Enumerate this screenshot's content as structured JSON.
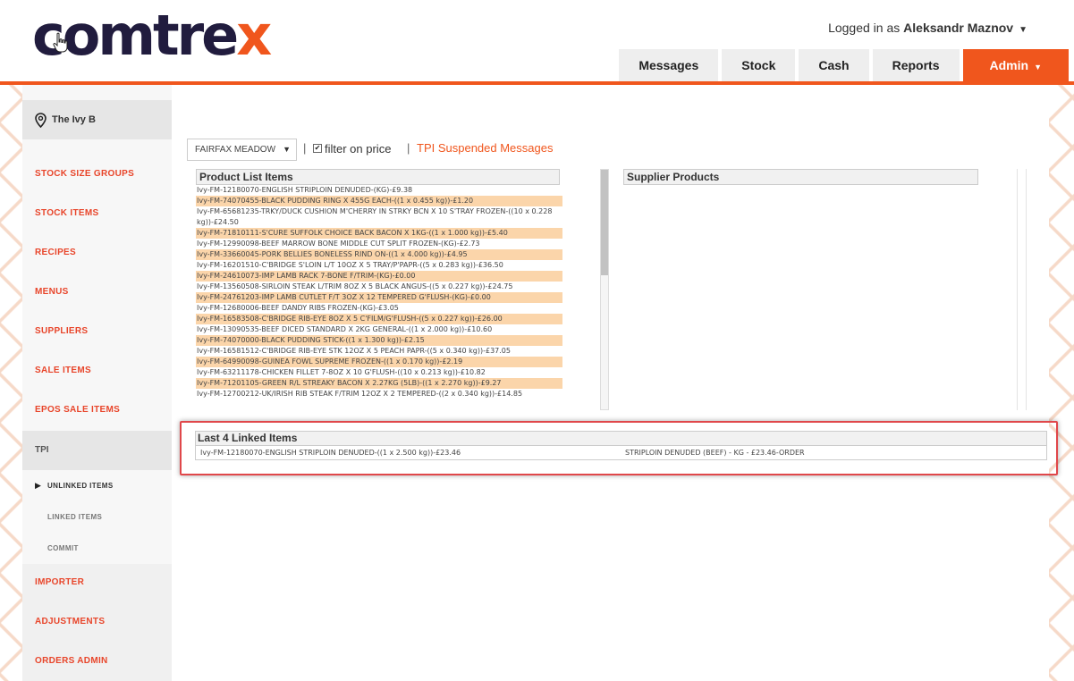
{
  "brand": {
    "logo_main": "comtre",
    "logo_accent": "x",
    "accent_color": "#f0561d",
    "navy": "#211c3e"
  },
  "user": {
    "prefix": "Logged in as ",
    "name": "Aleksandr Maznov"
  },
  "nav": {
    "messages": "Messages",
    "stock": "Stock",
    "cash": "Cash",
    "reports": "Reports",
    "admin": "Admin"
  },
  "sidebar": {
    "site": "The Ivy B",
    "items": {
      "stock_size_groups": "STOCK SIZE GROUPS",
      "stock_items": "STOCK ITEMS",
      "recipes": "RECIPES",
      "menus": "MENUS",
      "suppliers": "SUPPLIERS",
      "sale_items": "SALE ITEMS",
      "epos_sale_items": "EPOS SALE ITEMS",
      "tpi": "TPI",
      "unlinked_items": "UNLINKED ITEMS",
      "linked_items": "LINKED ITEMS",
      "commit": "COMMIT",
      "importer": "IMPORTER",
      "adjustments": "ADJUSTMENTS",
      "orders_admin": "ORDERS ADMIN"
    }
  },
  "toolbar": {
    "supplier_selected": "FAIRFAX MEADOW",
    "filter_label": "filter on price",
    "filter_checked": true,
    "tpi_link": "TPI Suspended Messages"
  },
  "product_list": {
    "title": "Product List Items",
    "items": [
      "Ivy-FM-12180070-ENGLISH STRIPLOIN DENUDED-(KG)-£9.38",
      "Ivy-FM-74070455-BLACK PUDDING RING X 455G EACH-((1 x 0.455 kg))-£1.20",
      "Ivy-FM-65681235-TRKY/DUCK CUSHION M'CHERRY IN STRKY BCN X 10 S'TRAY FROZEN-((10 x 0.228 kg))-£24.50",
      "Ivy-FM-71810111-S'CURE SUFFOLK CHOICE BACK BACON X 1KG-((1 x 1.000 kg))-£5.40",
      "Ivy-FM-12990098-BEEF MARROW BONE MIDDLE CUT SPLIT FROZEN-(KG)-£2.73",
      "Ivy-FM-33660045-PORK BELLIES BONELESS RIND ON-((1 x 4.000 kg))-£4.95",
      "Ivy-FM-16201510-C'BRIDGE S'LOIN L/T 10OZ X 5 TRAY/P'PAPR-((5 x 0.283 kg))-£36.50",
      "Ivy-FM-24610073-IMP LAMB RACK 7-BONE F/TRIM-(KG)-£0.00",
      "Ivy-FM-13560508-SIRLOIN STEAK L/TRIM 8OZ X 5 BLACK ANGUS-((5 x 0.227 kg))-£24.75",
      "Ivy-FM-24761203-IMP LAMB CUTLET F/T 3OZ X 12 TEMPERED G'FLUSH-(KG)-£0.00",
      "Ivy-FM-12680006-BEEF DANDY RIBS FROZEN-(KG)-£3.05",
      "Ivy-FM-16583508-C'BRIDGE RIB-EYE 8OZ X 5 C'FILM/G'FLUSH-((5 x 0.227 kg))-£26.00",
      "Ivy-FM-13090535-BEEF DICED STANDARD X 2KG GENERAL-((1 x 2.000 kg))-£10.60",
      "Ivy-FM-74070000-BLACK PUDDING STICK-((1 x 1.300 kg))-£2.15",
      "Ivy-FM-16581512-C'BRIDGE RIB-EYE STK 12OZ X 5 PEACH PAPR-((5 x 0.340 kg))-£37.05",
      "Ivy-FM-64990098-GUINEA FOWL SUPREME FROZEN-((1 x 0.170 kg))-£2.19",
      "Ivy-FM-63211178-CHICKEN FILLET 7-8OZ X 10 G'FLUSH-((10 x 0.213 kg))-£10.82",
      "Ivy-FM-71201105-GREEN R/L STREAKY BACON X 2.27KG (5LB)-((1 x 2.270 kg))-£9.27",
      "Ivy-FM-12700212-UK/IRISH RIB STEAK F/TRIM 12OZ X 2 TEMPERED-((2 x 0.340 kg))-£14.85"
    ]
  },
  "supplier_products": {
    "title": "Supplier Products"
  },
  "linked": {
    "title": "Last 4 Linked Items",
    "rows": [
      {
        "product": "Ivy-FM-12180070-ENGLISH STRIPLOIN DENUDED-((1 x 2.500 kg))-£23.46",
        "supplier": "STRIPLOIN DENUDED (BEEF) - KG - £23.46-ORDER"
      }
    ]
  }
}
